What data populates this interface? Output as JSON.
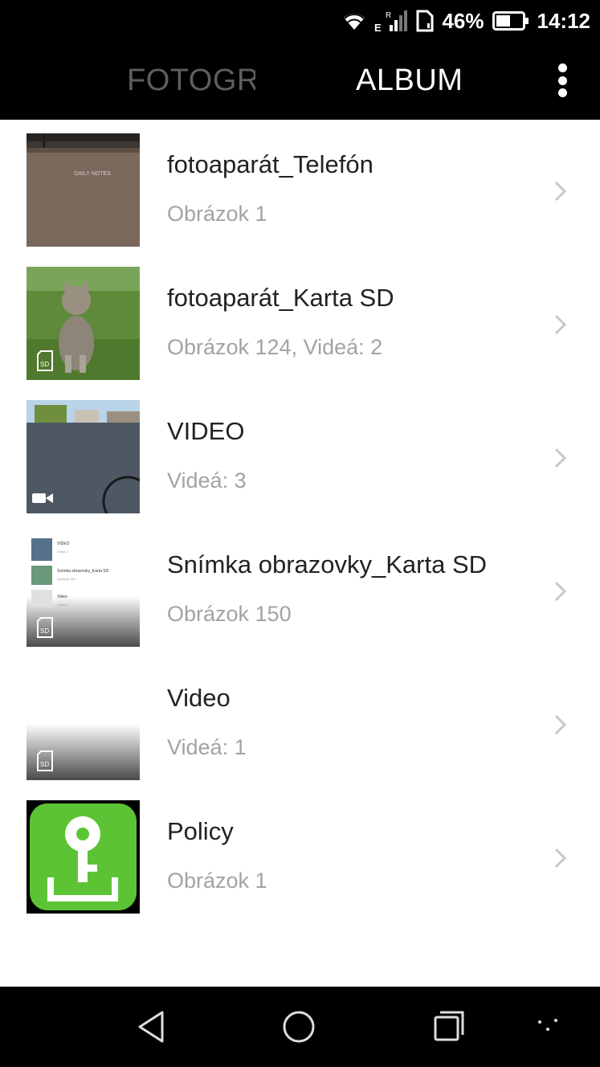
{
  "status_bar": {
    "battery_percent": "46%",
    "time": "14:12",
    "network_type": "E",
    "roaming_indicator": "R",
    "icons": [
      "wifi-icon",
      "signal-icon",
      "sim-icon",
      "battery-icon"
    ]
  },
  "header": {
    "tabs": [
      {
        "label": "FOTOGRAFIE",
        "active": false
      },
      {
        "label": "ALBUM",
        "active": true
      }
    ],
    "menu_icon": "overflow-menu-icon"
  },
  "albums": [
    {
      "title": "fotoaparát_Telefón",
      "subtitle": "Obrázok 1",
      "badge": null
    },
    {
      "title": "fotoaparát_Karta SD",
      "subtitle": "Obrázok 124, Videá: 2",
      "badge": "sd-card-icon"
    },
    {
      "title": "VIDEO",
      "subtitle": "Videá: 3",
      "badge": "video-camera-icon"
    },
    {
      "title": "Snímka obrazovky_Karta SD",
      "subtitle": "Obrázok 150",
      "badge": "sd-card-icon"
    },
    {
      "title": "Video",
      "subtitle": "Videá: 1",
      "badge": "sd-card-icon"
    },
    {
      "title": "Policy",
      "subtitle": "Obrázok 1",
      "badge": null
    }
  ],
  "thumbnail_text": {
    "notebook_label": "DAILY NOTES",
    "mini_list": [
      {
        "title": "VIDEO",
        "subtitle": "Videá 3"
      },
      {
        "title": "Snímka obrazovky_Karta SD",
        "subtitle": "Obrázok 150"
      },
      {
        "title": "Video",
        "subtitle": "Videá 1"
      }
    ],
    "sd_label": "SD"
  },
  "nav_bar": {
    "icons": [
      "back-icon",
      "home-icon",
      "recents-icon",
      "extra-nav-icon"
    ]
  },
  "colors": {
    "background": "#ffffff",
    "bar_background": "#000000",
    "title_text": "#222222",
    "subtitle_text": "#a3a3a3",
    "inactive_tab": "#5e5e5e",
    "policy_green": "#5cc434"
  }
}
